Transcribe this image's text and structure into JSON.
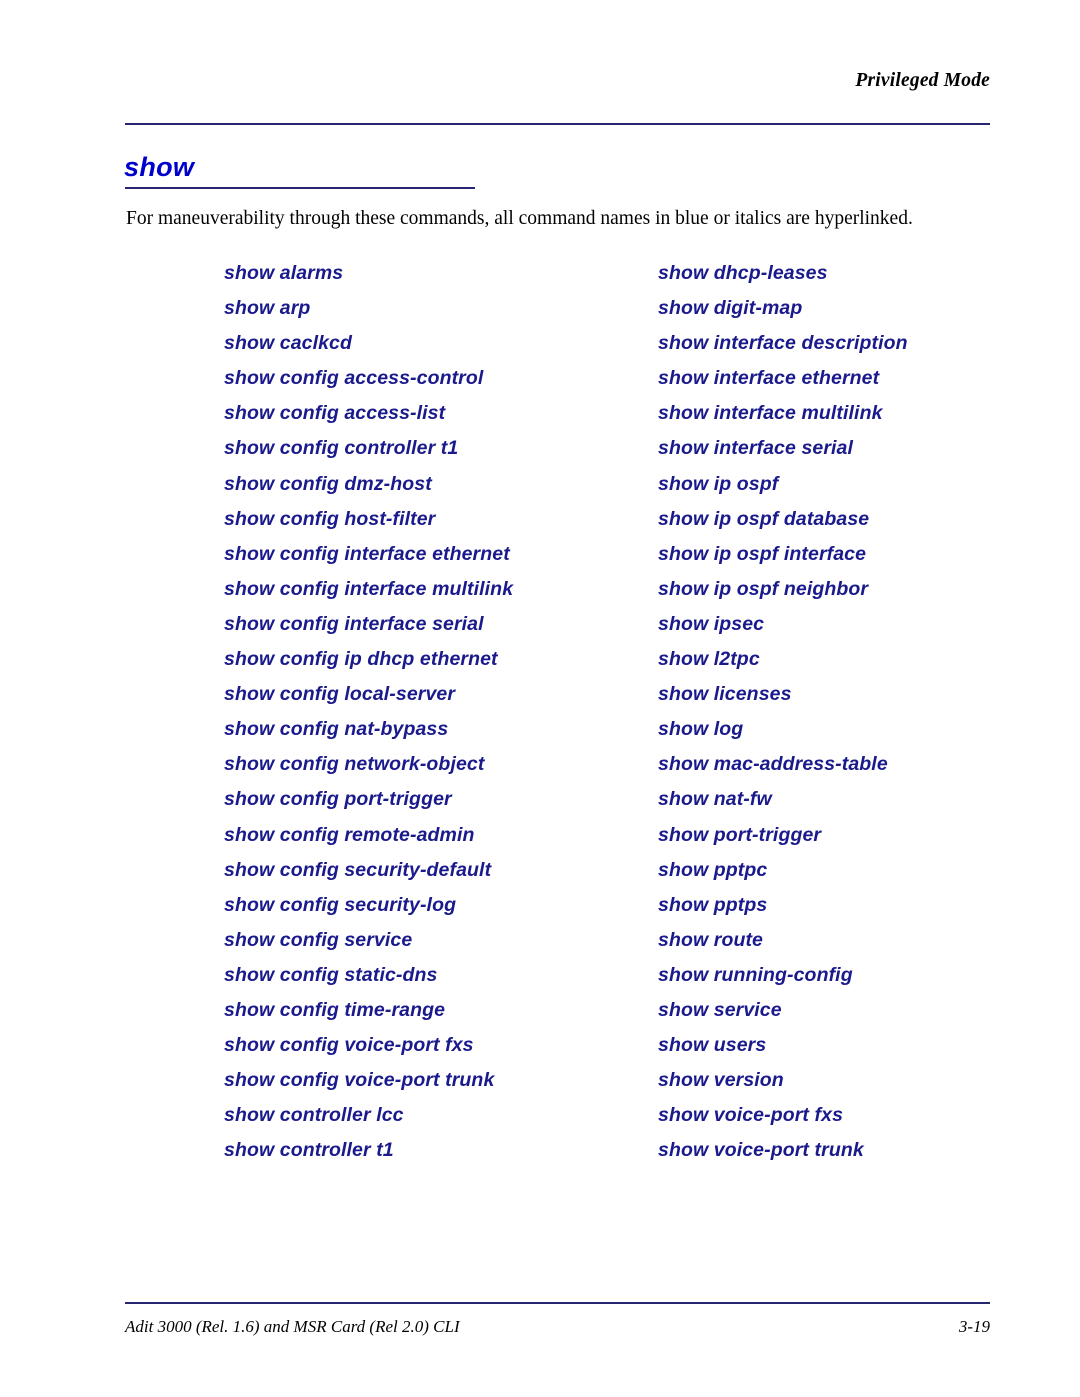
{
  "header": {
    "running_title": "Privileged Mode"
  },
  "section": {
    "title": "show",
    "intro": "For maneuverability through these commands, all command names in blue or italics are hyperlinked."
  },
  "colors": {
    "heading_blue": "#0000cc",
    "command_blue": "#1a1a8c",
    "rule_blue": "#262673",
    "body_text": "#000000",
    "page_background": "#ffffff"
  },
  "commands": {
    "left_column": [
      "show alarms",
      "show arp",
      "show caclkcd",
      "show config access-control",
      "show config access-list",
      "show config controller t1",
      "show config dmz-host",
      "show config host-filter",
      "show config interface ethernet",
      "show config interface multilink",
      "show config interface serial",
      "show config ip dhcp ethernet",
      "show config local-server",
      "show config nat-bypass",
      "show config network-object",
      "show config port-trigger",
      "show config remote-admin",
      "show config security-default",
      "show config security-log",
      "show config service",
      "show config static-dns",
      "show config time-range",
      "show config voice-port fxs",
      "show config voice-port trunk",
      "show controller lcc",
      "show controller t1"
    ],
    "right_column": [
      "show dhcp-leases",
      "show digit-map",
      "show interface description",
      "show interface ethernet",
      "show interface multilink",
      "show interface serial",
      "show ip ospf",
      "show ip ospf database",
      "show ip ospf interface",
      "show ip ospf neighbor",
      "show ipsec",
      "show l2tpc",
      "show licenses",
      "show log",
      "show mac-address-table",
      "show nat-fw",
      "show port-trigger",
      "show pptpc",
      "show pptps",
      "show route",
      "show running-config",
      "show service",
      "show users",
      "show version",
      "show voice-port fxs",
      "show voice-port trunk"
    ]
  },
  "footer": {
    "document_title": "Adit 3000 (Rel. 1.6) and MSR Card (Rel 2.0) CLI",
    "page_number": "3-19"
  }
}
